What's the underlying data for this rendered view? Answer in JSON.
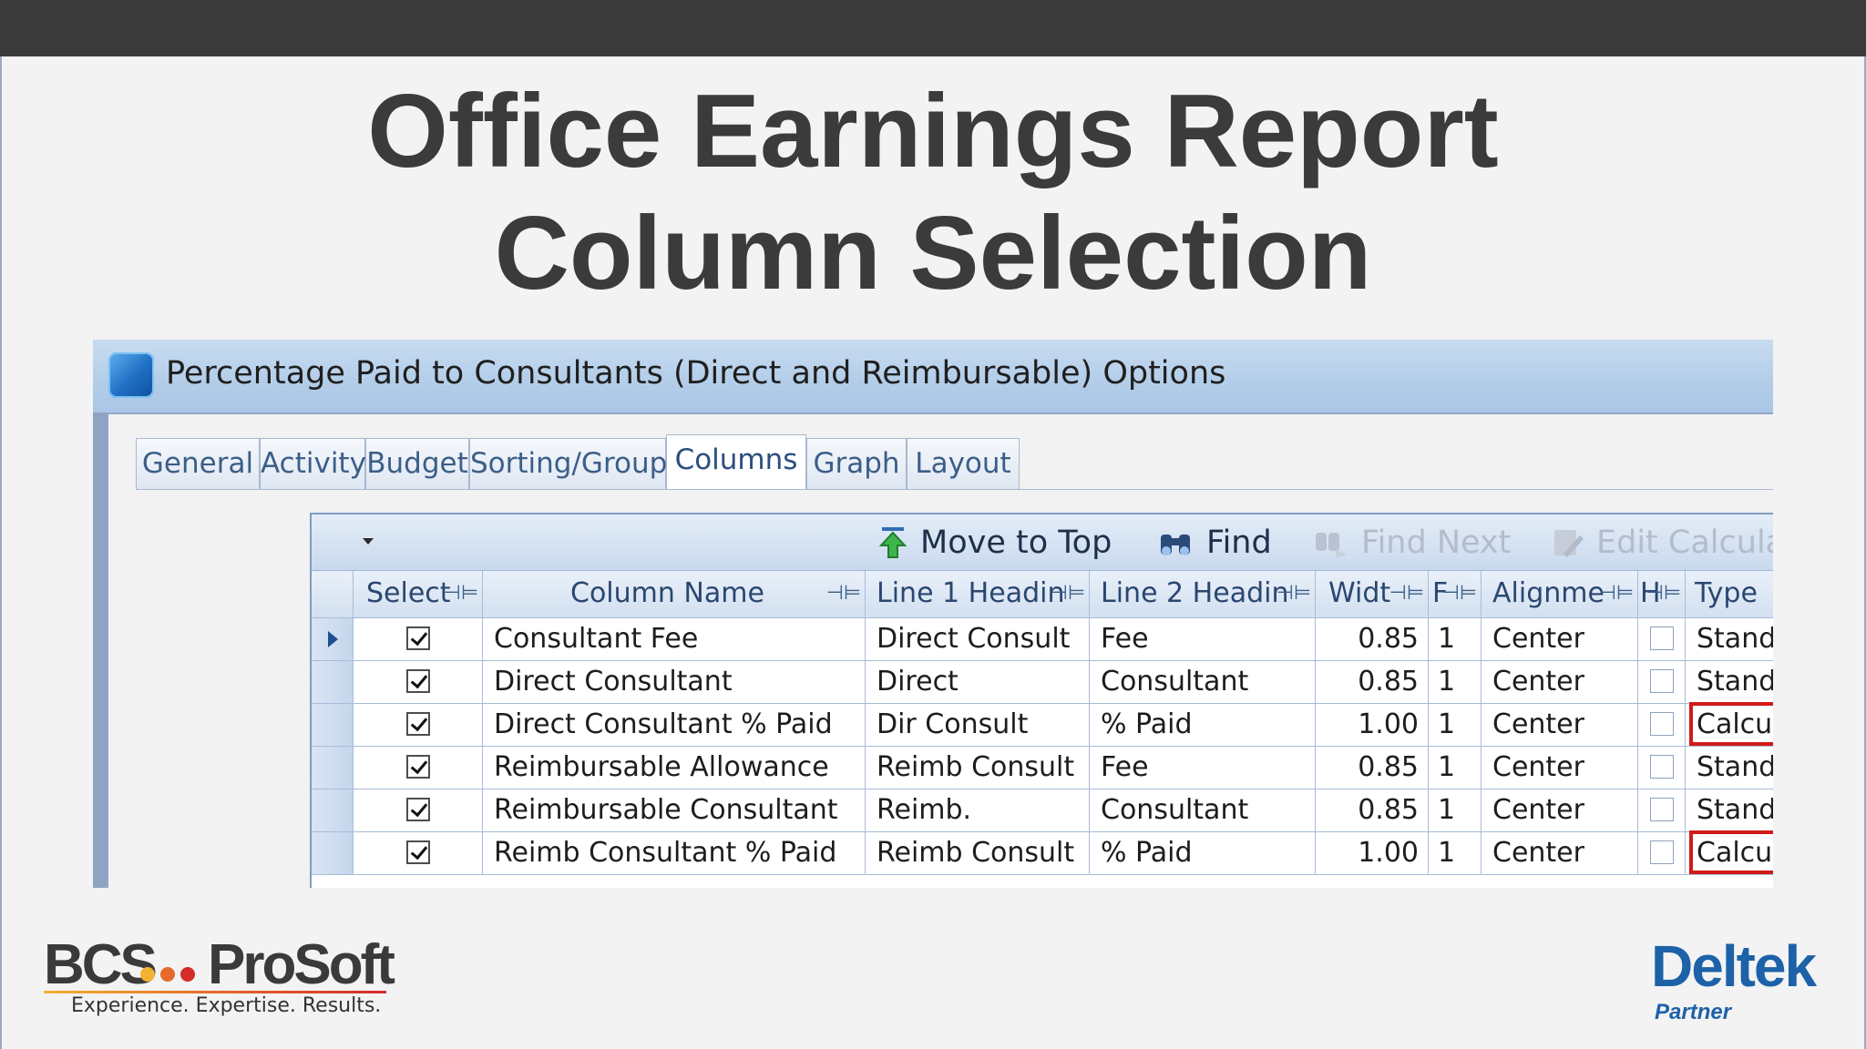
{
  "slide": {
    "title_line1": "Office Earnings Report",
    "title_line2": "Column Selection"
  },
  "window": {
    "title": "Percentage Paid to Consultants (Direct and Reimbursable) Options",
    "tabs": [
      {
        "label": "General",
        "active": false
      },
      {
        "label": "Activity",
        "active": false
      },
      {
        "label": "Budget",
        "active": false
      },
      {
        "label": "Sorting/Grouping",
        "active": false
      },
      {
        "label": "Columns",
        "active": true
      },
      {
        "label": "Graph",
        "active": false
      },
      {
        "label": "Layout",
        "active": false
      }
    ]
  },
  "toolbar": {
    "move_to_top": "Move to Top",
    "find": "Find",
    "find_next": "Find Next",
    "edit_calculation": "Edit Calculation"
  },
  "grid": {
    "headers": {
      "select": "Select",
      "column_name": "Column Name",
      "line1": "Line 1 Headin",
      "line2": "Line 2 Headin",
      "width": "Widt",
      "f": "F",
      "alignment": "Alignme",
      "h": "H",
      "type": "Type"
    },
    "rows": [
      {
        "selected": true,
        "column_name": "Consultant Fee",
        "line1": "Direct Consult",
        "line2": "Fee",
        "width": "0.85",
        "f": "1",
        "alignment": "Center",
        "h": false,
        "type": "Standard",
        "highlight": false,
        "current": true
      },
      {
        "selected": true,
        "column_name": "Direct Consultant",
        "line1": "Direct",
        "line2": "Consultant",
        "width": "0.85",
        "f": "1",
        "alignment": "Center",
        "h": false,
        "type": "Standard",
        "highlight": false,
        "current": false
      },
      {
        "selected": true,
        "column_name": "Direct Consultant % Paid",
        "line1": "Dir Consult",
        "line2": "% Paid",
        "width": "1.00",
        "f": "1",
        "alignment": "Center",
        "h": false,
        "type": "Calculated",
        "highlight": true,
        "current": false
      },
      {
        "selected": true,
        "column_name": "Reimbursable Allowance",
        "line1": "Reimb Consult",
        "line2": "Fee",
        "width": "0.85",
        "f": "1",
        "alignment": "Center",
        "h": false,
        "type": "Standard",
        "highlight": false,
        "current": false
      },
      {
        "selected": true,
        "column_name": "Reimbursable Consultant",
        "line1": "Reimb.",
        "line2": "Consultant",
        "width": "0.85",
        "f": "1",
        "alignment": "Center",
        "h": false,
        "type": "Standard",
        "highlight": false,
        "current": false
      },
      {
        "selected": true,
        "column_name": "Reimb Consultant % Paid",
        "line1": "Reimb Consult",
        "line2": "% Paid",
        "width": "1.00",
        "f": "1",
        "alignment": "Center",
        "h": false,
        "type": "Calculated",
        "highlight": true,
        "current": false
      }
    ]
  },
  "footer": {
    "bcs_name_left": "BCS",
    "bcs_name_right": "ProSoft",
    "bcs_tagline": "Experience. Expertise. Results.",
    "deltek_name": "Deltek",
    "deltek_partner": "Partner"
  },
  "colors": {
    "highlight_box": "#d11a1a",
    "deltek_blue": "#1d62a8",
    "topbar": "#3b3b3b"
  }
}
